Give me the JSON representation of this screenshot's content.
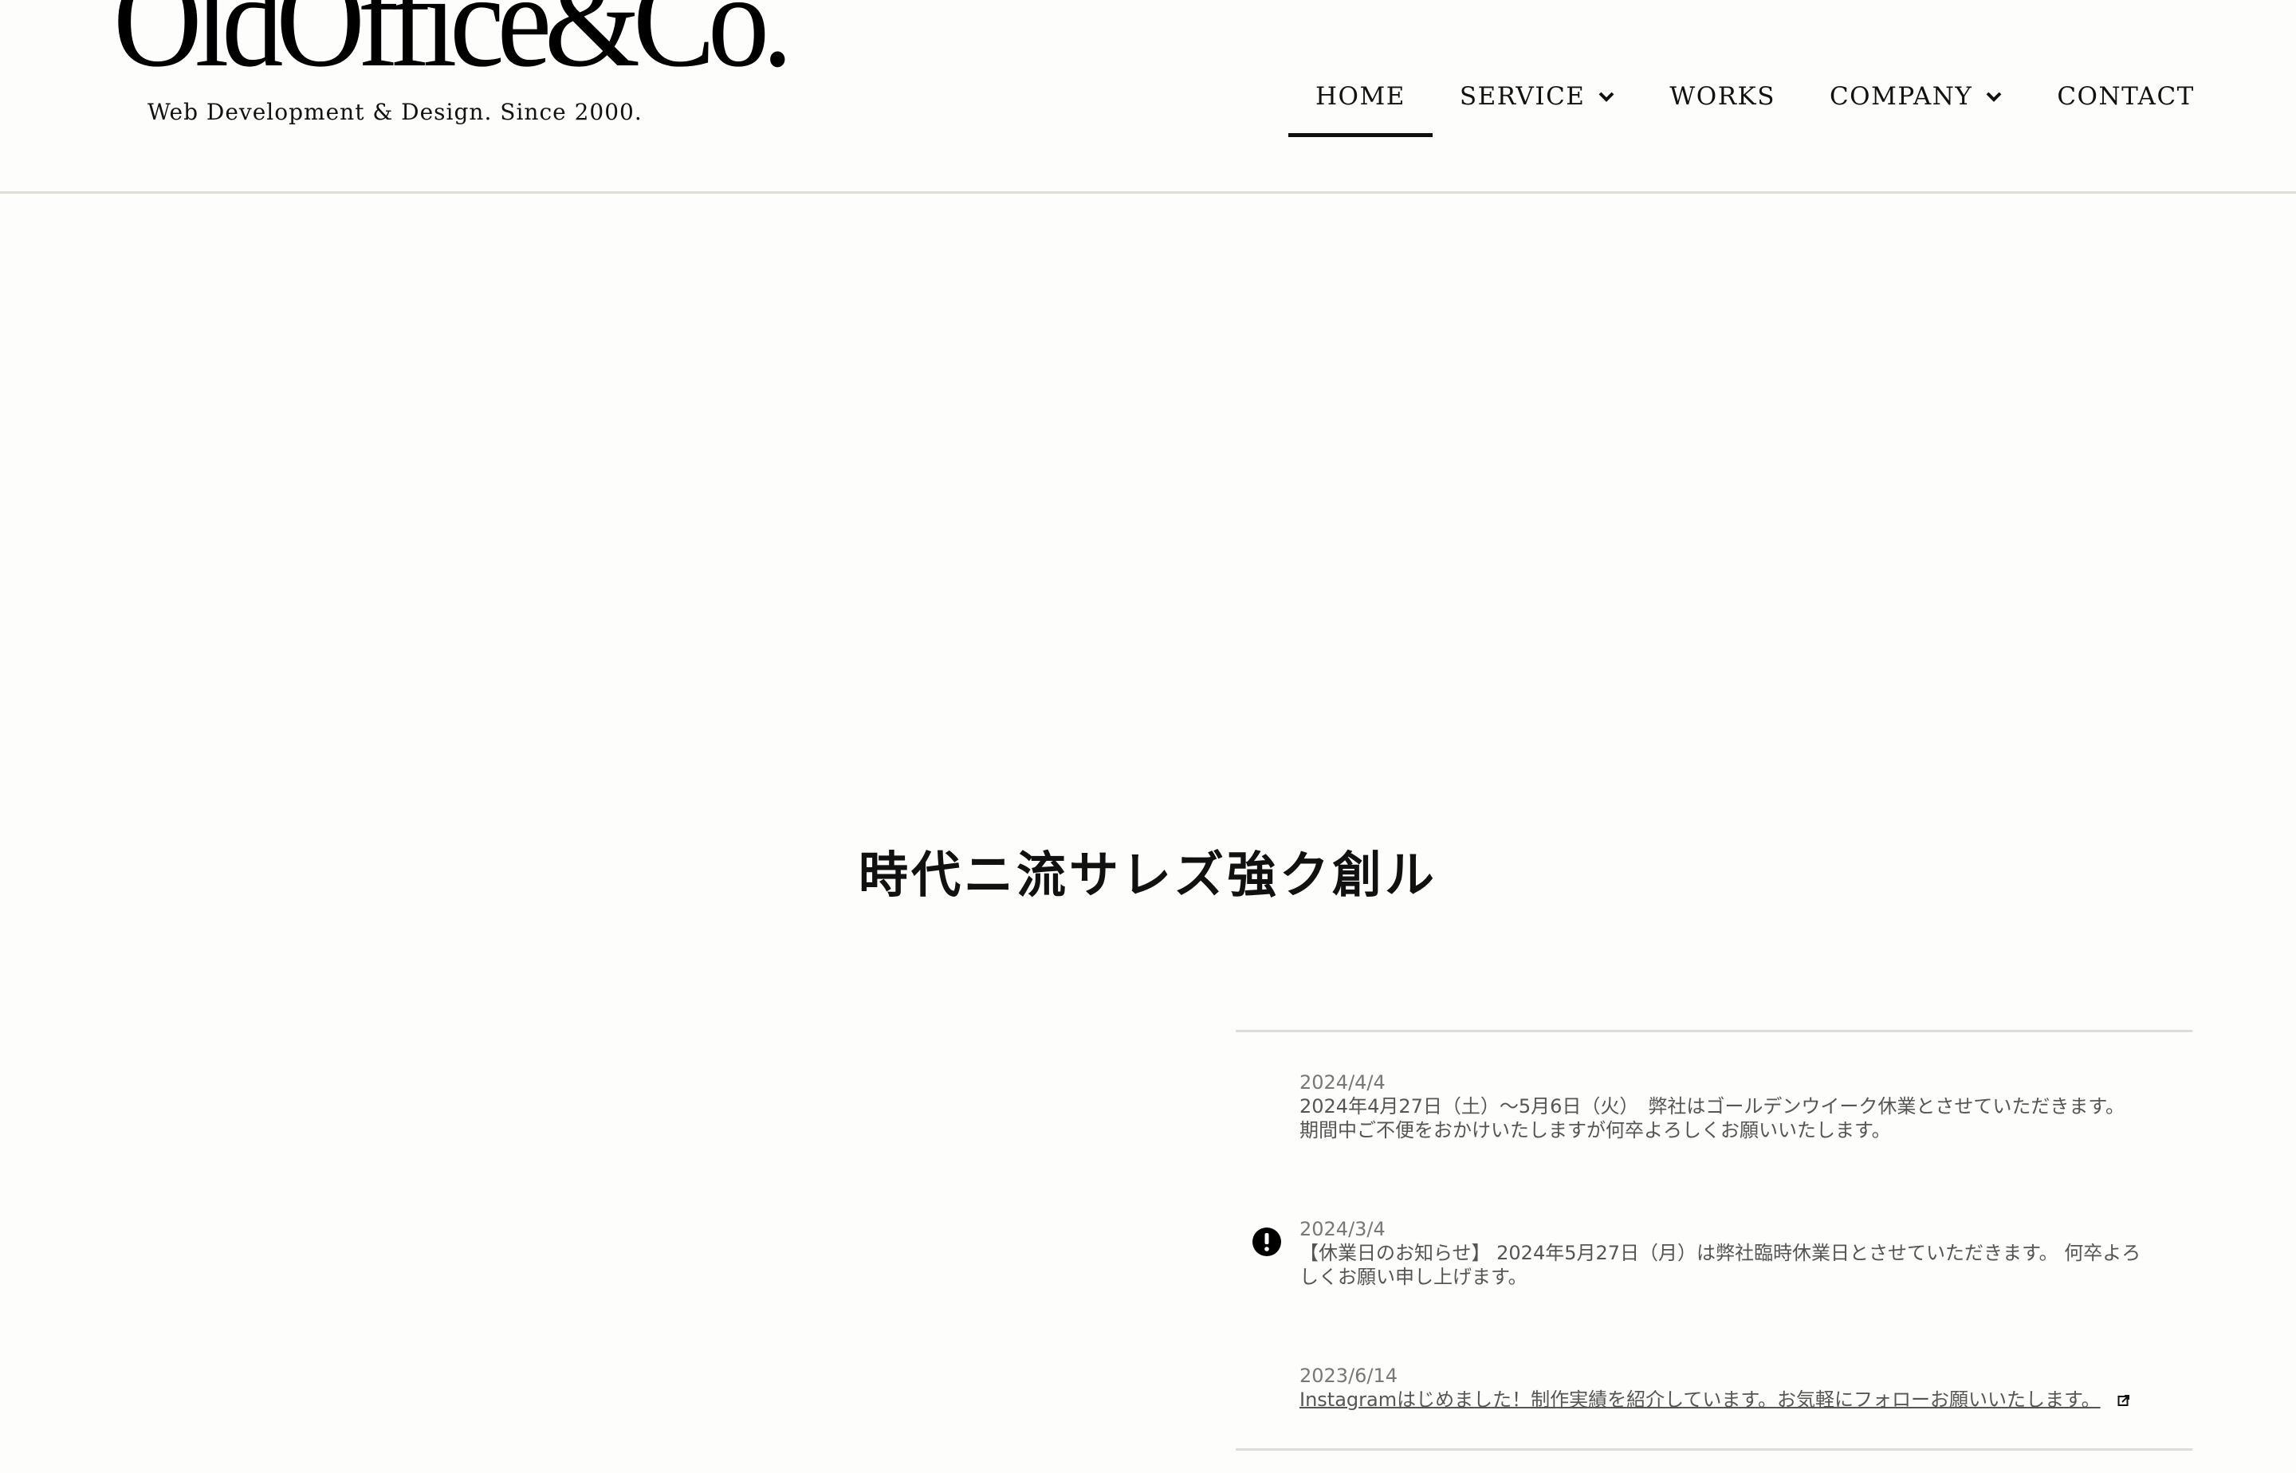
{
  "header": {
    "logo_text": "OldOffice&Co.",
    "tagline": "Web Development & Design. Since 2000."
  },
  "nav": {
    "items": [
      {
        "label": "HOME",
        "active": true,
        "has_dropdown": false
      },
      {
        "label": "SERVICE",
        "active": false,
        "has_dropdown": true
      },
      {
        "label": "WORKS",
        "active": false,
        "has_dropdown": false
      },
      {
        "label": "COMPANY",
        "active": false,
        "has_dropdown": true
      },
      {
        "label": "CONTACT",
        "active": false,
        "has_dropdown": false
      }
    ],
    "dropdown_icon": "chevron-down-icon"
  },
  "hero": {
    "title": "時代ニ流サレズ強ク創ル"
  },
  "news": {
    "items": [
      {
        "date": "2024/4/4",
        "line1": "2024年4月27日（土）～5月6日（火）　弊社はゴールデンウイーク休業とさせていただきます。",
        "line2": "期間中ご不便をおかけいたしますが何卒よろしくお願いいたします。",
        "icon": null,
        "is_link": false
      },
      {
        "date": "2024/3/4",
        "line1": "【休業日のお知らせ】 2024年5月27日（月）は弊社臨時休業日とさせていただきます。 何卒よろ",
        "line2": "しくお願い申し上げます。",
        "icon": "exclamation-circle-icon",
        "is_link": false
      },
      {
        "date": "2023/6/14",
        "line1": "Instagramはじめました！制作実績を紹介しています。お気軽にフォローお願いいたします。",
        "icon": "external-link-icon",
        "is_link": true
      }
    ]
  },
  "colors": {
    "background": "#fdfdfb",
    "text": "#111111",
    "news_text": "#555555",
    "news_date": "#777777",
    "divider": "#dcdcdc"
  }
}
